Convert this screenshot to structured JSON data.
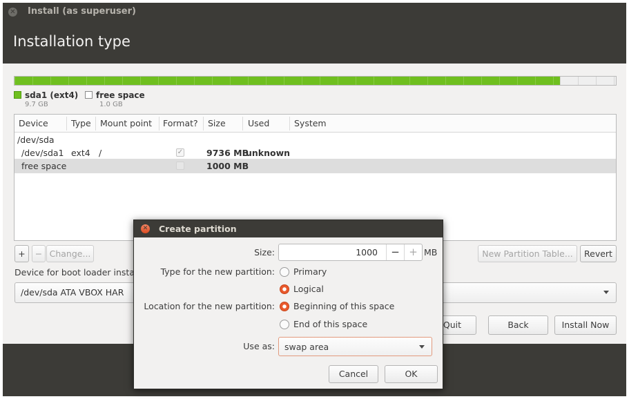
{
  "window": {
    "title": "Install (as superuser)",
    "heading": "Installation type"
  },
  "colors": {
    "used_partition": "#6fbf1f",
    "free_space": "#efefef",
    "header_bg": "#3c3b37",
    "accent": "#e9592c"
  },
  "partition_bar": {
    "used_fraction": 0.907,
    "legend": [
      {
        "name": "sda1 (ext4)",
        "size": "9.7 GB",
        "swatch": "green-square"
      },
      {
        "name": "free space",
        "size": "1.0 GB",
        "swatch": "empty-square"
      }
    ]
  },
  "table": {
    "headers": [
      "Device",
      "Type",
      "Mount point",
      "Format?",
      "Size",
      "Used",
      "System"
    ],
    "rows": [
      {
        "device": "/dev/sda",
        "type": "",
        "mount": "",
        "format": "",
        "size": "",
        "used": "",
        "system": ""
      },
      {
        "device": "/dev/sda1",
        "type": "ext4",
        "mount": "/",
        "format": "checked",
        "size": "9736 MB",
        "used": "unknown",
        "system": ""
      },
      {
        "device": "free space",
        "type": "",
        "mount": "",
        "format": "unchecked",
        "size": "1000 MB",
        "used": "",
        "system": "",
        "selected": true
      }
    ]
  },
  "controls": {
    "add": "+",
    "remove": "−",
    "change": "Change...",
    "new_table": "New Partition Table...",
    "revert": "Revert",
    "bootloader_label": "Device for boot loader insta",
    "bootloader_value": "/dev/sda   ATA VBOX HAR"
  },
  "footer": {
    "quit": "Quit",
    "back": "Back",
    "install": "Install Now"
  },
  "dialog": {
    "title": "Create partition",
    "size_label": "Size:",
    "size_value": "1000",
    "size_unit": "MB",
    "minus": "−",
    "plus": "+",
    "type_label": "Type for the new partition:",
    "type_options": [
      "Primary",
      "Logical"
    ],
    "type_selected": "Logical",
    "location_label": "Location for the new partition:",
    "location_options": [
      "Beginning of this space",
      "End of this space"
    ],
    "location_selected": "Beginning of this space",
    "use_as_label": "Use as:",
    "use_as_value": "swap area",
    "cancel": "Cancel",
    "ok": "OK"
  }
}
